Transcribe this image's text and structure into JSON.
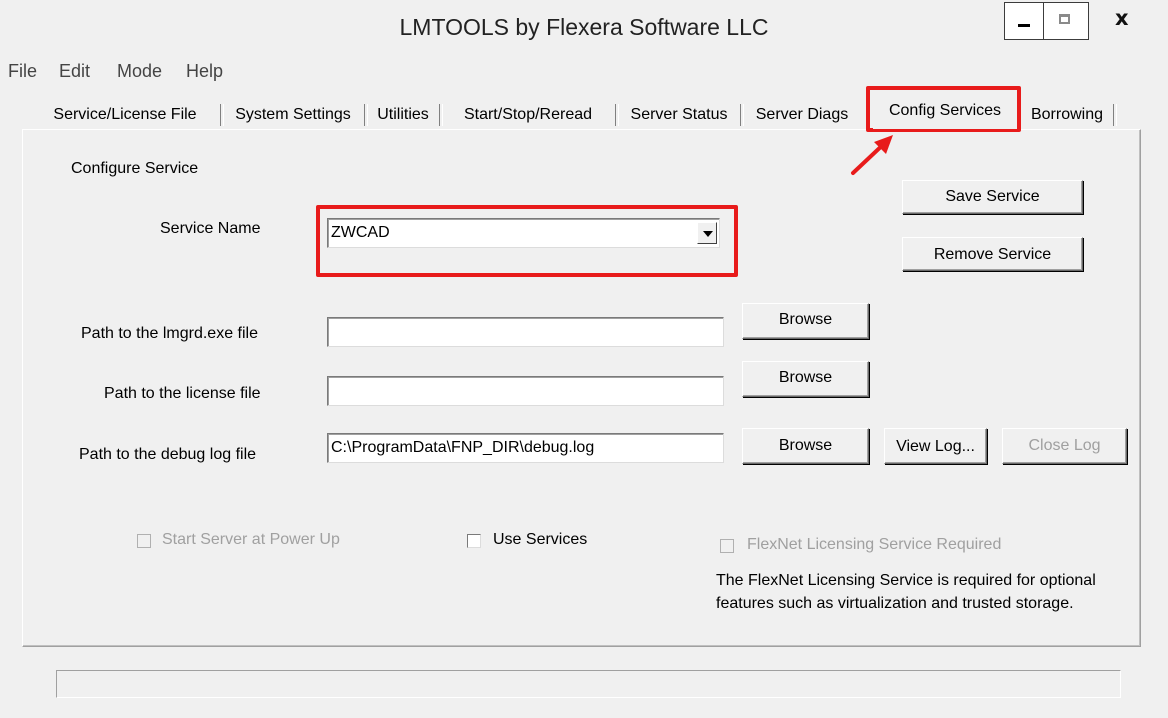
{
  "window": {
    "title": "LMTOOLS by Flexera Software LLC"
  },
  "titlebar_controls": {
    "close_glyph": "x"
  },
  "menu": [
    "File",
    "Edit",
    "Mode",
    "Help"
  ],
  "tabs": [
    {
      "label": "Service/License File"
    },
    {
      "label": "System Settings"
    },
    {
      "label": "Utilities"
    },
    {
      "label": "Start/Stop/Reread"
    },
    {
      "label": "Server Status"
    },
    {
      "label": "Server Diags"
    },
    {
      "label": "Config Services",
      "selected": true
    },
    {
      "label": "Borrowing"
    }
  ],
  "config": {
    "section_label": "Configure Service",
    "service_name_label": "Service Name",
    "service_name_value": "ZWCAD",
    "lmgrd_label": "Path to the lmgrd.exe file",
    "lmgrd_value": "",
    "license_label": "Path to the license file",
    "license_value": "",
    "debug_label": "Path to the debug log file",
    "debug_value": "C:\\ProgramData\\FNP_DIR\\debug.log",
    "save_service": "Save Service",
    "remove_service": "Remove Service",
    "browse": "Browse",
    "view_log": "View Log...",
    "close_log": "Close Log",
    "start_server_label": "Start Server at Power Up",
    "use_services_label": "Use Services",
    "flexnet_required_label": "FlexNet Licensing Service Required",
    "flexnet_note_line1": "The FlexNet Licensing Service is required for optional",
    "flexnet_note_line2": "features such as virtualization and trusted storage."
  },
  "status_bar": {
    "text": ""
  },
  "annotation": {
    "highlight_color": "#e81b1b"
  }
}
